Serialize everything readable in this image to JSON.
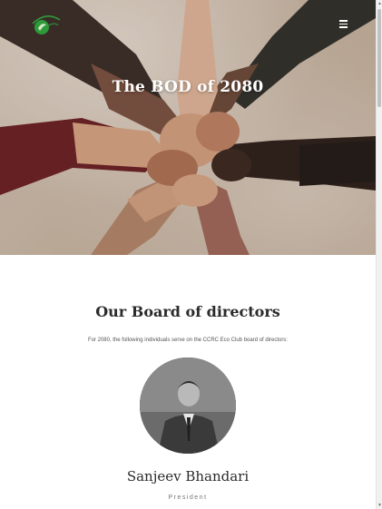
{
  "hero": {
    "title": "The BOD of 2080"
  },
  "header": {
    "logo_icon": "eco-club-logo-icon",
    "menu_icon": "hamburger-menu-icon"
  },
  "board": {
    "title": "Our Board of directors",
    "intro": "For 2080, the following individuals serve on the CCRC Eco Club board of directors:"
  },
  "member": {
    "name": "Sanjeev Bhandari",
    "role": "President",
    "photo_icon": "portrait-photo"
  },
  "colors": {
    "hero_text": "#ffffff",
    "heading": "#2b2b2b",
    "logo_green": "#2e9b3a"
  }
}
